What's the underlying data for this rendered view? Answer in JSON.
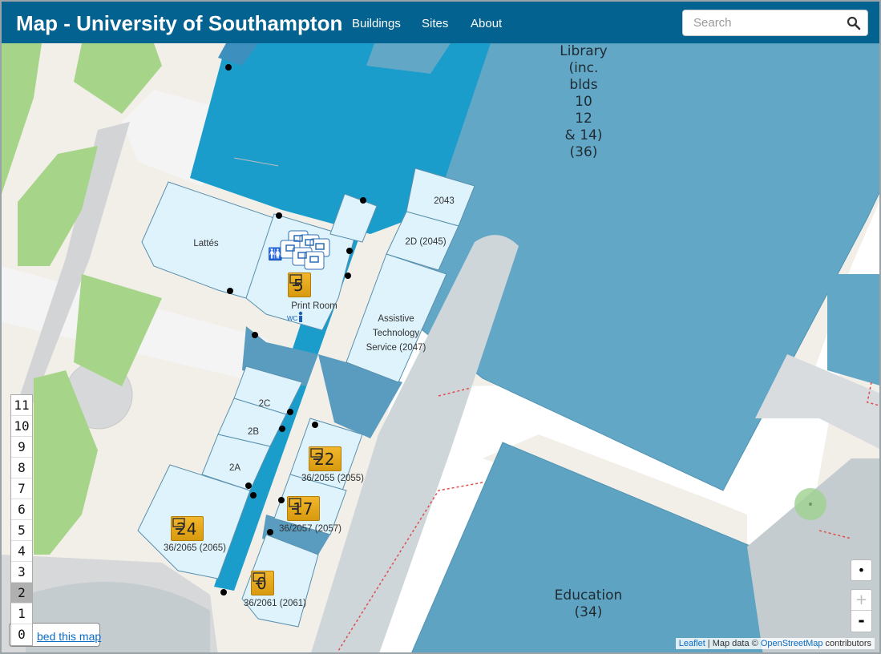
{
  "header": {
    "title": "Map - University of Southampton",
    "nav": [
      "Buildings",
      "Sites",
      "About"
    ],
    "search_placeholder": "Search"
  },
  "map": {
    "buildings": {
      "library": [
        "Library",
        "(inc.",
        "blds",
        "10",
        "12",
        "& 14)",
        "(36)"
      ],
      "education": [
        "Education",
        "(34)"
      ]
    },
    "rooms": {
      "lattes": "Lattés",
      "r2043": "2043",
      "r2d": "2D (2045)",
      "print_room": "Print Room",
      "ats": [
        "Assistive",
        "Technology",
        "Service (2047)"
      ],
      "r2c": "2C",
      "r2b": "2B",
      "r2a": "2A"
    },
    "computer_markers": [
      {
        "count": "5",
        "label": ""
      },
      {
        "count": "22",
        "label": "36/2055 (2055)"
      },
      {
        "count": "17",
        "label": "36/2057 (2057)"
      },
      {
        "count": "24",
        "label": "36/2065 (2065)"
      },
      {
        "count": "0",
        "label": "36/2061 (2061)"
      }
    ],
    "toilet_label": "WC"
  },
  "levels": {
    "items": [
      "11",
      "10",
      "9",
      "8",
      "7",
      "6",
      "5",
      "4",
      "3",
      "2",
      "1",
      "0"
    ],
    "active": "2"
  },
  "embed_label": "bed this map",
  "controls": {
    "locate": "•",
    "zoom_in": "+",
    "zoom_out": "-"
  },
  "attribution": {
    "leaflet": "Leaflet",
    "separator": " | Map data © ",
    "osm": "OpenStreetMap",
    "suffix": " contributors"
  },
  "colors": {
    "navbar": "#03628f",
    "building": "#63a7c6",
    "corridor": "#1ba0cb",
    "room": "#def3fb",
    "grass": "#a6d58a",
    "path": "#cfd6da",
    "marker": "#f0b429"
  }
}
